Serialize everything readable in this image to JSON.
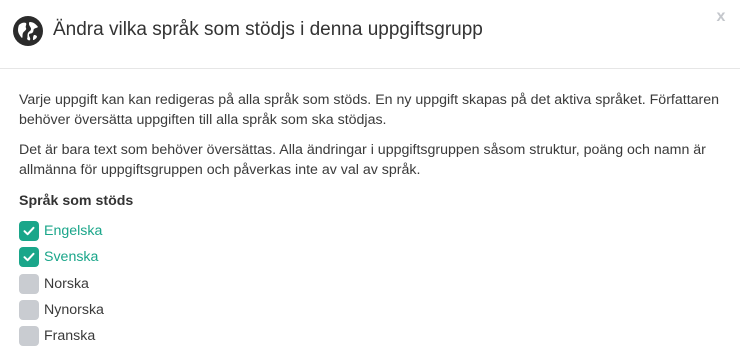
{
  "modal": {
    "icon": "globe-icon",
    "title": "Ändra vilka språk som stödjs i denna uppgiftsgrupp",
    "close_label": "x",
    "paragraphs": [
      "Varje uppgift kan kan redigeras på alla språk som stöds. En ny uppgift skapas på det aktiva språket. Författaren behöver översätta uppgiften till alla språk som ska stödjas.",
      "Det är bara text som behöver översättas. Alla ändringar i uppgiftsgruppen såsom struktur, poäng och namn är allmänna för uppgiftsgruppen och påverkas inte av val av språk."
    ],
    "section_title": "Språk som stöds",
    "languages": [
      {
        "label": "Engelska",
        "checked": true
      },
      {
        "label": "Svenska",
        "checked": true
      },
      {
        "label": "Norska",
        "checked": false
      },
      {
        "label": "Nynorska",
        "checked": false
      },
      {
        "label": "Franska",
        "checked": false
      }
    ]
  },
  "colors": {
    "accent": "#1aa68a",
    "unchecked": "#c9ccd1",
    "icon_dark": "#2b2b2b",
    "close": "#c4c7cc"
  }
}
